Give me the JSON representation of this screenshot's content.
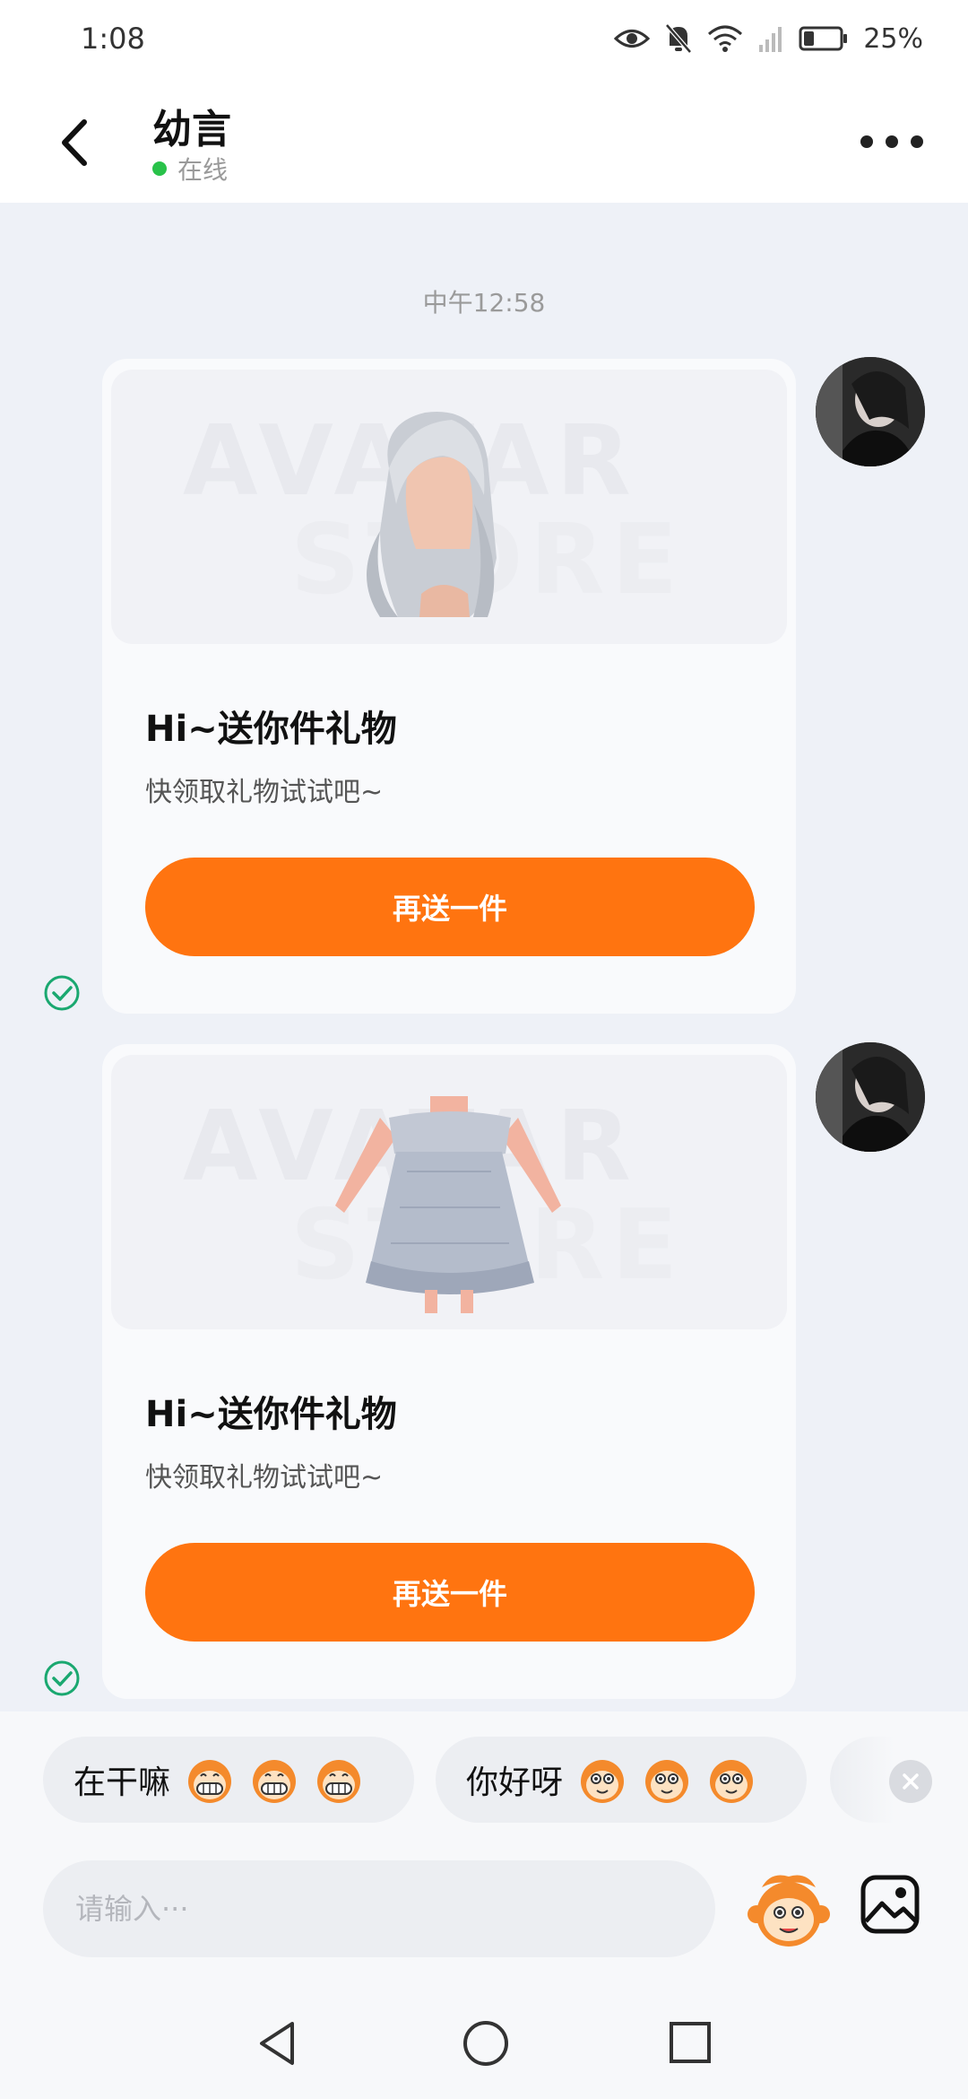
{
  "status_bar": {
    "time": "1:08",
    "battery": "25%",
    "icons": [
      "eye-icon",
      "bell-off-icon",
      "wifi-icon",
      "signal-icon",
      "battery-icon"
    ]
  },
  "header": {
    "contact_name": "幼言",
    "status": "在线",
    "status_color": "#29c24a"
  },
  "chat": {
    "timestamp": "中午12:58",
    "messages": [
      {
        "type": "gift-card",
        "item": "white-hair",
        "title": "Hi~送你件礼物",
        "subtitle": "快领取礼物试试吧~",
        "button": "再送一件",
        "delivered": true
      },
      {
        "type": "gift-card",
        "item": "blue-dress",
        "title": "Hi~送你件礼物",
        "subtitle": "快领取礼物试试吧~",
        "button": "再送一件",
        "delivered": true
      }
    ]
  },
  "quick_replies": [
    {
      "text": "在干嘛",
      "emoji": "grin-monkey-icon"
    },
    {
      "text": "你好呀",
      "emoji": "smile-monkey-icon"
    }
  ],
  "composer": {
    "placeholder": "请输入···",
    "value": ""
  },
  "colors": {
    "accent": "#ff7410",
    "check": "#1aa870",
    "background": "#eef1f7"
  }
}
